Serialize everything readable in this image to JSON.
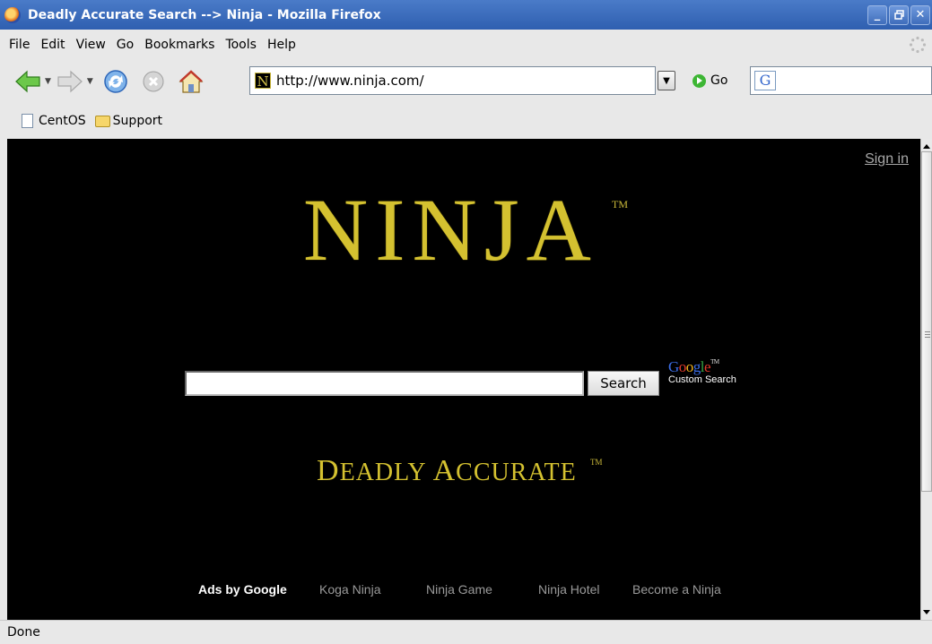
{
  "window": {
    "title": "Deadly Accurate Search --> Ninja - Mozilla Firefox",
    "controls": [
      "_",
      "̀",
      "X"
    ]
  },
  "menu": [
    {
      "label": "File"
    },
    {
      "label": "Edit"
    },
    {
      "label": "View"
    },
    {
      "label": "Go"
    },
    {
      "label": "Bookmarks"
    },
    {
      "label": "Tools"
    },
    {
      "label": "Help"
    }
  ],
  "toolbar": {
    "url": "http://www.ninja.com/",
    "favicon_letter": "N",
    "go_label": "Go",
    "search_engine_letter": "G",
    "search_value": ""
  },
  "bookmarks": [
    {
      "label": "CentOS",
      "icon": "page-icon"
    },
    {
      "label": "Support",
      "icon": "folder-icon"
    }
  ],
  "page": {
    "signin": "Sign in",
    "logo": "NINJA",
    "logo_tm": "TM",
    "search_value": "",
    "search_button": "Search",
    "google_word": [
      "G",
      "o",
      "o",
      "g",
      "l",
      "e"
    ],
    "google_tm": "TM",
    "custom_search": "Custom Search",
    "tagline_d": "D",
    "tagline_rest1": "EADLY ",
    "tagline_a": "A",
    "tagline_rest2": "CCURATE",
    "tagline_tm": "TM",
    "ads_label": "Ads by Google",
    "ads": [
      "Koga Ninja",
      "Ninja Game",
      "Ninja Hotel",
      "Become a Ninja"
    ]
  },
  "status": "Done",
  "colors": {
    "gold": "#d4c130",
    "page_bg": "#000000",
    "titlebar": "#3a68b8"
  }
}
